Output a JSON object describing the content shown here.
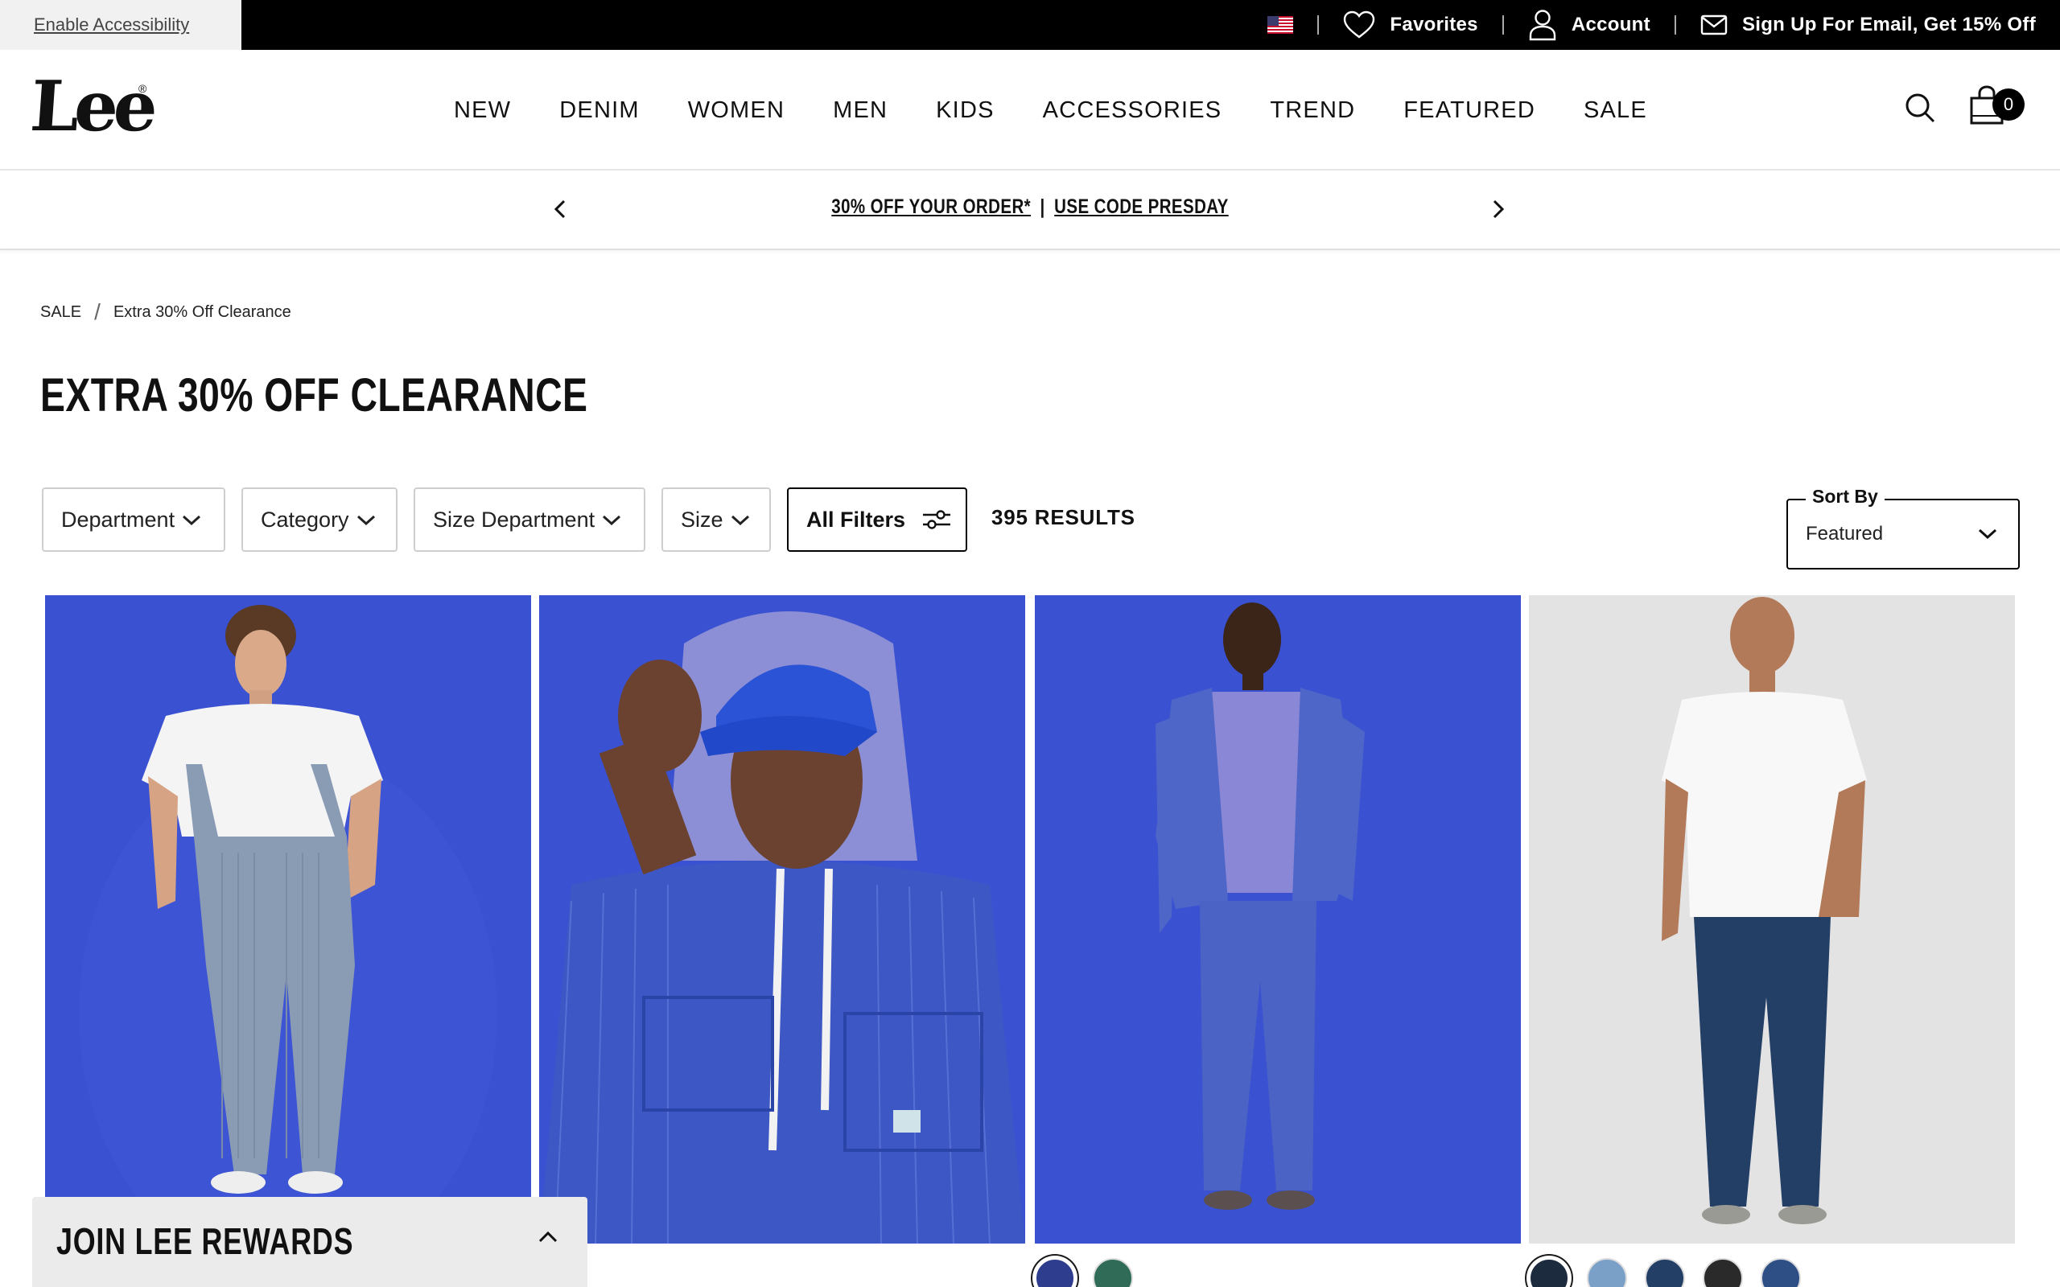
{
  "utility": {
    "accessibility_link": "Enable Accessibility",
    "favorites": "Favorites",
    "account": "Account",
    "email_signup": "Sign Up For Email, Get 15% Off"
  },
  "header": {
    "logo": "Lee",
    "nav": [
      "NEW",
      "DENIM",
      "WOMEN",
      "MEN",
      "KIDS",
      "ACCESSORIES",
      "TREND",
      "FEATURED",
      "SALE"
    ],
    "cart_count": "0"
  },
  "promo": {
    "offer": "30% OFF YOUR ORDER*",
    "separator": "|",
    "code": "USE CODE PRESDAY"
  },
  "breadcrumb": {
    "root": "SALE",
    "separator": "/",
    "current": "Extra 30% Off Clearance"
  },
  "page_title": "EXTRA 30% OFF CLEARANCE",
  "filters": {
    "department": "Department",
    "category": "Category",
    "size_department": "Size Department",
    "size": "Size",
    "all_filters": "All Filters",
    "results": "395 RESULTS"
  },
  "sort": {
    "label": "Sort By",
    "value": "Featured"
  },
  "products": [
    {
      "image": "man in striped denim overalls and white tee on blue background",
      "swatches": []
    },
    {
      "image": "man in blue cap, lavender hoodie and striped chore jacket on blue background",
      "swatches": []
    },
    {
      "image": "man in blue denim jacket and pants with lavender hoodie on blue background",
      "swatches": [
        "#2f3d8f",
        "#2f6b56"
      ]
    },
    {
      "image": "man in white tee and dark wash jeans on light grey background",
      "swatches": [
        "#1c2b3d",
        "#7aa0c8",
        "#233f66",
        "#2a2a2a",
        "#2d4f86"
      ]
    }
  ],
  "rewards": {
    "title": "JOIN LEE REWARDS"
  },
  "colors": {
    "utility_bg": "#000000",
    "product_blue": "#3a52d1",
    "drawer_bg": "#ebebeb"
  }
}
